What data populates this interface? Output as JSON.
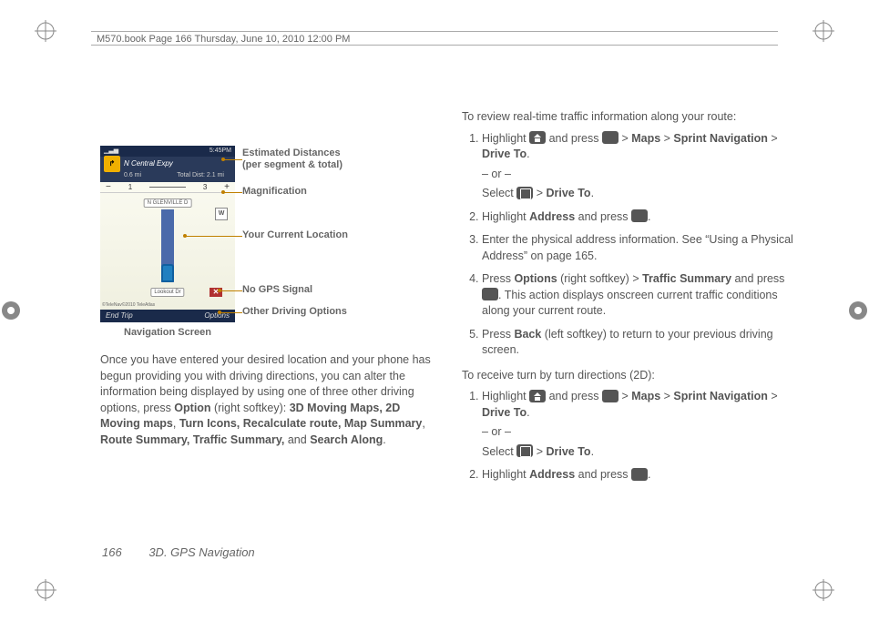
{
  "header": "M570.book  Page 166  Thursday, June 10, 2010  12:00 PM",
  "figure": {
    "topbar_left": "▁▃▅",
    "topbar_right": "5:45PM",
    "titlebar": "N Central Expy",
    "dist_left": "0.6 mi",
    "dist_right": "Total Dist:  2.1 mi",
    "mag_minus": "−",
    "mag_plus": "+",
    "mag_label": "3",
    "mag_left_label": "1",
    "street_top": "N GLENVILLE D",
    "compass": "W",
    "street_bottom": "Lookout Dr",
    "sat_x": "✕",
    "copyright": "©TeleNav©2010 TeleAtlas",
    "soft_left": "End Trip",
    "soft_right": "Options",
    "caption": "Navigation Screen"
  },
  "callouts": {
    "c1a": "Estimated Distances",
    "c1b": " (per segment & total)",
    "c2": "Magnification",
    "c3": "Your Current Location",
    "c4": "No GPS Signal",
    "c5": "Other Driving Options"
  },
  "left_para": {
    "p1": "Once you have entered your desired location and your phone has begun providing you with driving directions, you can alter the information being displayed by using one of three other driving options, press ",
    "opt": "Option",
    "p1b": " (right softkey): ",
    "bold": "3D Moving Maps, 2D Moving maps",
    "comma1": ", ",
    "bold2": "Turn Icons, Recalculate route, Map Summary",
    "comma2": ", ",
    "bold3": "Route Summary, Traffic Summary,",
    "and": " and ",
    "bold4": "Search Along",
    "dot": "."
  },
  "right": {
    "intro1": "To review real-time traffic information along your route:",
    "s1a": "Highlight ",
    "s1b": " and press ",
    "gt": " > ",
    "maps": "Maps",
    "sprint_nav": "Sprint Navigation",
    "drive_to": "Drive To",
    "or": "– or –",
    "select": "Select ",
    "s2a": "Highlight ",
    "address": "Address",
    "s2b": " and press ",
    "s3": "Enter the physical address information. See “Using a Physical Address” on page 165.",
    "s4a": "Press ",
    "options": "Options",
    "s4b": " (right softkey)",
    "traffic": "Traffic Summary",
    "s4c": " and press ",
    "s4d": ". This action displays onscreen current traffic conditions along your current route.",
    "s5a": "Press ",
    "back": "Back",
    "s5b": " (left softkey) to return to your previous driving screen.",
    "intro2": "To receive turn by turn directions (2D):"
  },
  "footer": {
    "page": "166",
    "section": "3D. GPS Navigation"
  }
}
